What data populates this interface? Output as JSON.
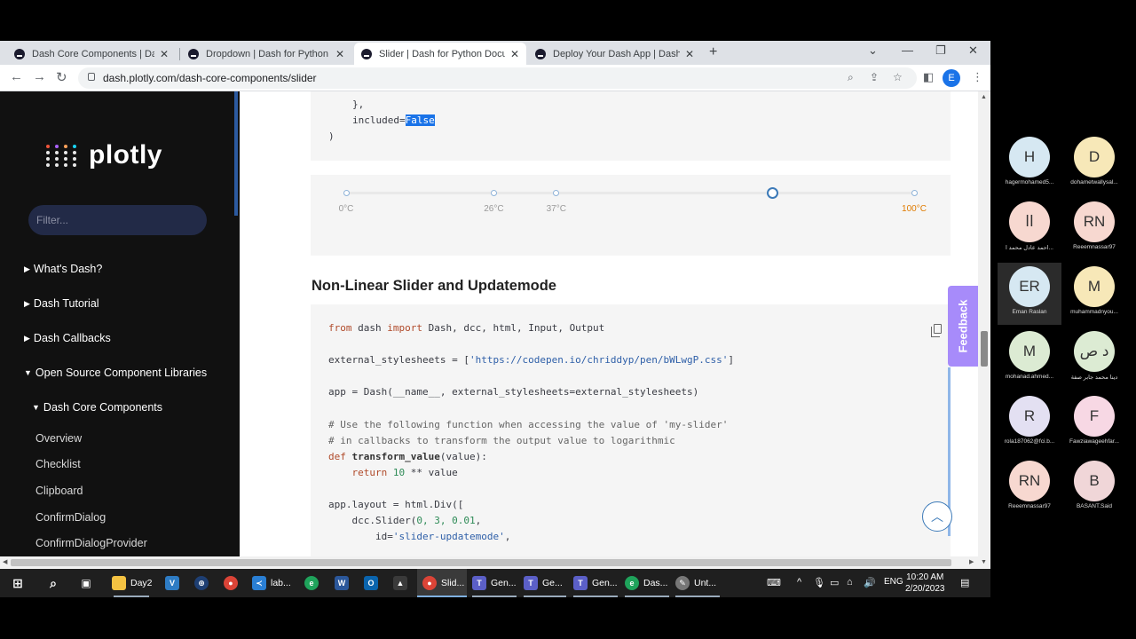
{
  "browser": {
    "tabs": [
      {
        "title": "Dash Core Components | Dash fo"
      },
      {
        "title": "Dropdown | Dash for Python Doc"
      },
      {
        "title": "Slider | Dash for Python Docume"
      },
      {
        "title": "Deploy Your Dash App | Dash fo"
      }
    ],
    "url": "dash.plotly.com/dash-core-components/slider",
    "profile_initial": "E"
  },
  "sidebar": {
    "logo_text": "plotly",
    "filter_placeholder": "Filter...",
    "sections": [
      {
        "label": "What's Dash?"
      },
      {
        "label": "Dash Tutorial"
      },
      {
        "label": "Dash Callbacks"
      },
      {
        "label": "Open Source Component Libraries"
      },
      {
        "label": "Dash Core Components"
      }
    ],
    "items": [
      {
        "label": "Overview"
      },
      {
        "label": "Checklist"
      },
      {
        "label": "Clipboard"
      },
      {
        "label": "ConfirmDialog"
      },
      {
        "label": "ConfirmDialogProvider"
      }
    ]
  },
  "code_top": {
    "line1": "},",
    "line2_prefix": "included=",
    "line2_value": "False",
    "line3": ")"
  },
  "slider_demo": {
    "marks": [
      {
        "label": "0°C",
        "value": 0
      },
      {
        "label": "26°C",
        "value": 26
      },
      {
        "label": "37°C",
        "value": 37
      },
      {
        "label": "100°C",
        "value": 100
      }
    ],
    "handle_value": 75,
    "hot_color": "#e07b00"
  },
  "section": {
    "title": "Non-Linear Slider and Updatemode"
  },
  "code": {
    "l1_kw1": "from",
    "l1_mid": " dash ",
    "l1_kw2": "import",
    "l1_rest": " Dash, dcc, html, Input, Output",
    "l2_pre": "external_stylesheets = [",
    "l2_str": "'https://codepen.io/chriddyp/pen/bWLwgP.css'",
    "l2_post": "]",
    "l3": "app = Dash(__name__, external_stylesheets=external_stylesheets)",
    "l4": "# Use the following function when accessing the value of 'my-slider'",
    "l5": "# in callbacks to transform the output value to logarithmic",
    "l6_kw": "def",
    "l6_fn": " transform_value",
    "l6_rest": "(value):",
    "l7_kw": "    return",
    "l7_num": " 10",
    "l7_rest": " ** value",
    "l8": "app.layout = html.Div([",
    "l9_pre": "    dcc.Slider(",
    "l9_nums": "0, 3, 0.01",
    "l9_post": ",",
    "l10_pre": "        id=",
    "l10_str": "'slider-updatemode'",
    "l10_post": ","
  },
  "feedback_label": "Feedback",
  "taskbar": {
    "items": [
      {
        "label": "Day2"
      },
      {
        "label": "lab..."
      },
      {
        "label": "Slid..."
      },
      {
        "label": "Gen..."
      },
      {
        "label": "Ge..."
      },
      {
        "label": "Gen..."
      },
      {
        "label": "Das..."
      },
      {
        "label": "Unt..."
      }
    ],
    "lang": "ENG",
    "time": "10:20 AM",
    "date": "2/20/2023"
  },
  "participants": [
    {
      "initials": "H",
      "name": "hagermohamed5...",
      "color": "#d6e8f2"
    },
    {
      "initials": "D",
      "name": "dohametwallysal...",
      "color": "#f7e8b8"
    },
    {
      "initials": "اا",
      "name": "احمد عادل محمد ا...",
      "color": "#f7d8d0"
    },
    {
      "initials": "RN",
      "name": "Reeemnassar97",
      "color": "#f7d8d0"
    },
    {
      "initials": "ER",
      "name": "Eman Raslan",
      "color": "#d6e8f2"
    },
    {
      "initials": "M",
      "name": "muhammadnyou...",
      "color": "#f7e8b8"
    },
    {
      "initials": "M",
      "name": "mohanad.ahmed...",
      "color": "#dcebd3"
    },
    {
      "initials": "د ص",
      "name": "دينا محمد جابر صفة",
      "color": "#dcebd3"
    },
    {
      "initials": "R",
      "name": "rola187062@fci.b...",
      "color": "#e3e0f2"
    },
    {
      "initials": "F",
      "name": "Fawziawageehfar...",
      "color": "#f7d8e4"
    },
    {
      "initials": "RN",
      "name": "Reeemnassar97",
      "color": "#f7d8d0"
    },
    {
      "initials": "B",
      "name": "BASANT.Said",
      "color": "#f0d6d8"
    }
  ]
}
